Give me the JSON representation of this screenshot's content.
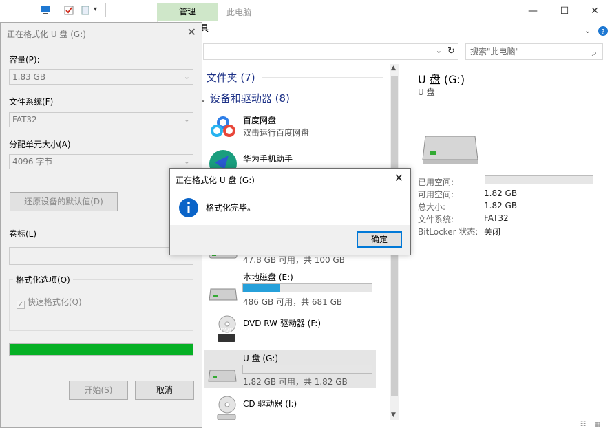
{
  "explorer": {
    "ribbon_tab_manage": "管理",
    "ribbon_tool_partial": "具",
    "window_title": "此电脑",
    "search_placeholder": "搜索\"此电脑\"",
    "sections": {
      "folders": "文件夹 (7)",
      "devices": "设备和驱动器 (8)"
    },
    "drives": [
      {
        "name": "百度网盘",
        "sub": "双击运行百度网盘"
      },
      {
        "name": "华为手机助手",
        "sub": ""
      },
      {
        "name": "",
        "sub": "47.8 GB 可用，共 100 GB"
      },
      {
        "name": "本地磁盘 (E:)",
        "sub": "486 GB 可用，共 681 GB",
        "used_fraction": 0.29
      },
      {
        "name": "DVD RW 驱动器 (F:)",
        "sub": "",
        "badge": "DVD"
      },
      {
        "name": "U 盘 (G:)",
        "sub": "1.82 GB 可用，共 1.82 GB",
        "used_fraction": 0.0
      },
      {
        "name": "CD 驱动器 (I:)",
        "sub": ""
      }
    ],
    "details": {
      "title": "U 盘 (G:)",
      "subtitle": "U 盘",
      "rows": [
        {
          "label": "已用空间:",
          "value": ""
        },
        {
          "label": "可用空间:",
          "value": "1.82 GB"
        },
        {
          "label": "总大小:",
          "value": "1.82 GB"
        },
        {
          "label": "文件系统:",
          "value": "FAT32"
        },
        {
          "label": "BitLocker 状态:",
          "value": "关闭"
        }
      ]
    }
  },
  "format_dialog": {
    "title": "正在格式化 U 盘 (G:)",
    "capacity_label": "容量(P):",
    "capacity_value": "1.83 GB",
    "filesystem_label": "文件系统(F)",
    "filesystem_value": "FAT32",
    "alloc_label": "分配单元大小(A)",
    "alloc_value": "4096 字节",
    "restore_button": "还原设备的默认值(D)",
    "volume_label": "卷标(L)",
    "volume_value": "",
    "options_label": "格式化选项(O)",
    "quick_format_label": "快速格式化(Q)",
    "quick_format_checked": true,
    "progress_fraction": 1.0,
    "start_button": "开始(S)",
    "cancel_button": "取消"
  },
  "message_box": {
    "title": "正在格式化 U 盘 (G:)",
    "message": "格式化完毕。",
    "ok_button": "确定"
  },
  "colors": {
    "progress_green": "#06b025",
    "capacity_blue": "#26a0da",
    "manage_tab_bg": "#cfe7c9",
    "info_blue": "#0a64c8"
  }
}
